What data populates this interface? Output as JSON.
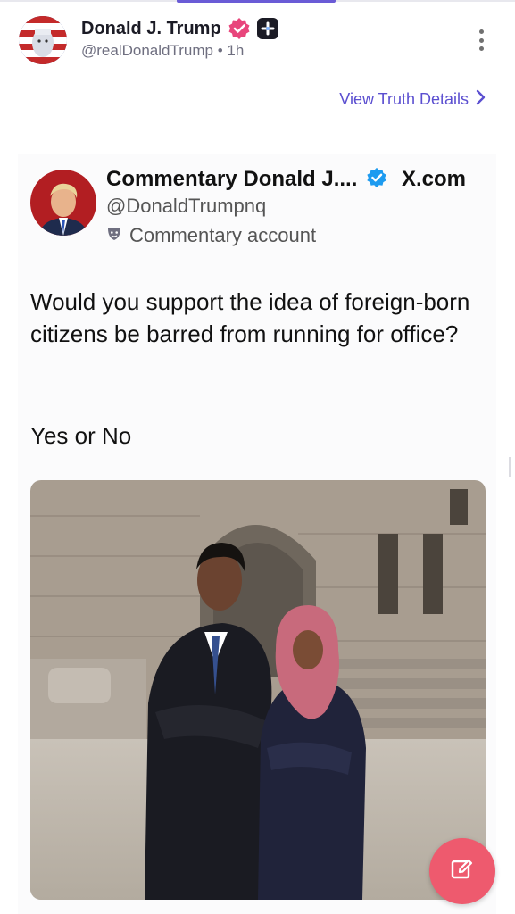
{
  "post": {
    "display_name": "Donald J. Trump",
    "handle": "@realDonaldTrump",
    "separator": "•",
    "time": "1h",
    "view_details_label": "View Truth Details"
  },
  "quoted": {
    "name": "Commentary Donald J....",
    "source": "X.com",
    "handle": "@DonaldTrumpnq",
    "account_label": "Commentary account",
    "text_line1": "Would you support the idea of foreign-born citizens be barred from running for office?",
    "text_line2": "Yes or No"
  },
  "colors": {
    "accent": "#5b4fd0",
    "verified_pink": "#e8467c",
    "verified_blue": "#1d9bf0",
    "fab": "#ee5a6e"
  },
  "icons": [
    "more-vertical-icon",
    "chevron-right-icon",
    "verified-badge-icon",
    "plus-badge-icon",
    "mask-icon",
    "compose-icon"
  ]
}
